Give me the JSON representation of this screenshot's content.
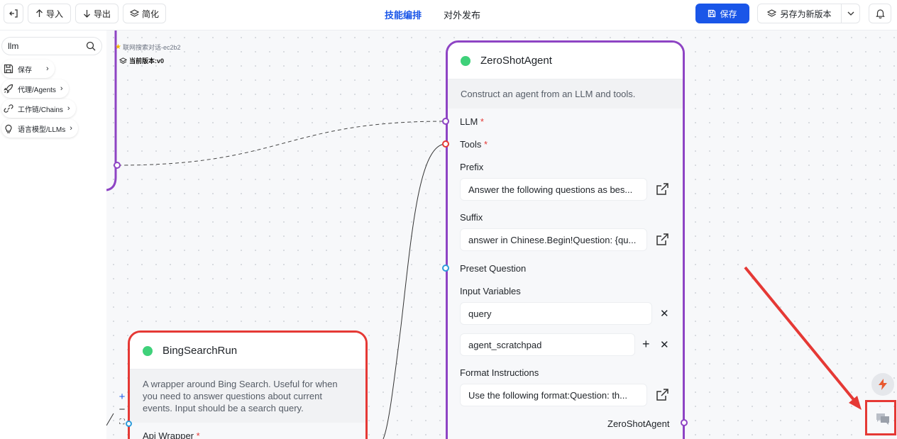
{
  "toolbar": {
    "import_label": "导入",
    "export_label": "导出",
    "simplify_label": "简化",
    "tabs": [
      {
        "label": "技能编排",
        "active": true
      },
      {
        "label": "对外发布",
        "active": false
      }
    ],
    "save_label": "保存",
    "save_as_label": "另存为新版本"
  },
  "sidebar": {
    "search_value": "llm",
    "categories": [
      {
        "label": "保存",
        "icon": "save-icon"
      },
      {
        "label": "代理/Agents",
        "icon": "rocket-icon"
      },
      {
        "label": "工作链/Chains",
        "icon": "link-icon"
      },
      {
        "label": "语言模型/LLMs",
        "icon": "lightbulb-icon"
      }
    ]
  },
  "flow": {
    "name": "联网搜索对话-ec2b2",
    "version": "当前版本:v0"
  },
  "agent_node": {
    "title": "ZeroShotAgent",
    "description": "Construct an agent from an LLM and tools.",
    "llm_label": "LLM",
    "tools_label": "Tools",
    "prefix_label": "Prefix",
    "prefix_value": "Answer the following questions as bes...",
    "suffix_label": "Suffix",
    "suffix_value": "answer in Chinese.Begin!Question: {qu...",
    "preset_question_label": "Preset Question",
    "input_variables_label": "Input Variables",
    "input_variables": [
      "query",
      "agent_scratchpad"
    ],
    "format_instructions_label": "Format Instructions",
    "format_instructions_value": "Use the following format:Question: th...",
    "output_label": "ZeroShotAgent",
    "accent_color": "#8e44c4"
  },
  "bing_node": {
    "title": "BingSearchRun",
    "description": "A wrapper around Bing Search. Useful for when you need to answer questions about current events. Input should be a search query.",
    "api_wrapper_label": "Api Wrapper",
    "accent_color": "#e53935"
  },
  "colors": {
    "primary": "#1a56e8",
    "status_green": "#3fd17a",
    "annotation_red": "#e53935"
  }
}
